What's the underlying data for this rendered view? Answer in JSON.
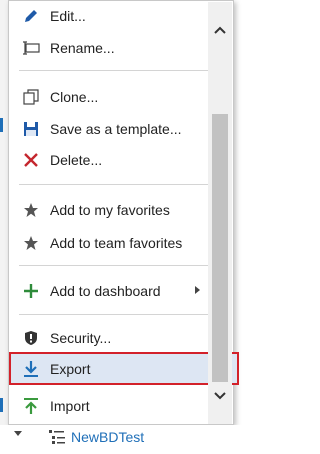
{
  "menu": {
    "items": [
      {
        "label": "Edit...",
        "icon": "pencil-icon"
      },
      {
        "label": "Rename...",
        "icon": "rename-icon"
      },
      {
        "label": "Clone...",
        "icon": "clone-icon"
      },
      {
        "label": "Save as a template...",
        "icon": "floppy-disk-icon"
      },
      {
        "label": "Delete...",
        "icon": "delete-x-icon"
      },
      {
        "label": "Add to my favorites",
        "icon": "star-icon"
      },
      {
        "label": "Add to team favorites",
        "icon": "star-icon"
      },
      {
        "label": "Add to dashboard",
        "icon": "plus-icon"
      },
      {
        "label": "Security...",
        "icon": "shield-icon"
      },
      {
        "label": "Export",
        "icon": "download-arrow-icon",
        "highlighted": true
      },
      {
        "label": "Import",
        "icon": "upload-arrow-icon"
      }
    ]
  },
  "tree": {
    "item_label": "NewBDTest"
  },
  "colors": {
    "accent_blue": "#1f6fb8",
    "highlight_border": "#d3212a",
    "highlight_bg": "#dde6f3",
    "delete_red": "#c4262e",
    "add_green": "#2e8b3a",
    "import_green": "#3a9a3e"
  }
}
